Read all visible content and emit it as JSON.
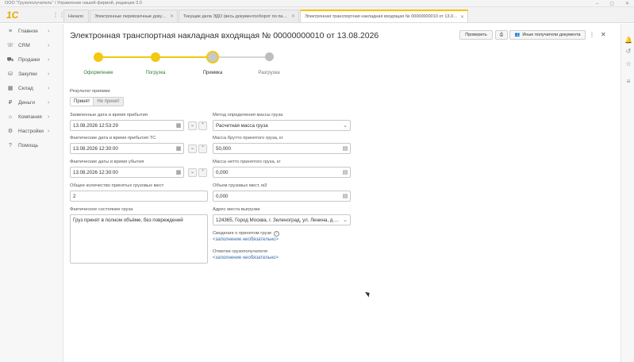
{
  "window": {
    "title": "ООО \"Грузополучатель\" / Управление нашей фирмой, редакция 3.0",
    "minimize": "–",
    "maximize": "▢",
    "close": "✕"
  },
  "logo": "1С",
  "tabs": [
    {
      "label": "Начало"
    },
    {
      "label": "Электронные перевозочные документы"
    },
    {
      "label": "Текущие дела ЭДО (весь документооборот по пакетам)"
    },
    {
      "label": "Электронная транспортная накладная входящая № 00000000010 от 13.08.2026"
    }
  ],
  "sidebar": {
    "items": [
      {
        "label": "Главное",
        "icon": "≡"
      },
      {
        "label": "CRM",
        "icon": "☏"
      },
      {
        "label": "Продажи",
        "icon": "⛟"
      },
      {
        "label": "Закупки",
        "icon": "⛁"
      },
      {
        "label": "Склад",
        "icon": "▦"
      },
      {
        "label": "Деньги",
        "icon": "₽"
      },
      {
        "label": "Компания",
        "icon": "⌂"
      },
      {
        "label": "Настройки",
        "icon": "⚙"
      },
      {
        "label": "Помощь",
        "icon": "?"
      }
    ]
  },
  "doc": {
    "title": "Электронная транспортная накладная входящая № 00000000010 от 13.08.2026",
    "check_button": "Проверить",
    "print_icon": "⎙",
    "other_recipients_button": "Иные получатели документа",
    "more_icon": "⋮",
    "close_icon": "✕"
  },
  "stepper": {
    "steps": [
      {
        "label": "Оформление",
        "state": "done"
      },
      {
        "label": "Погрузка",
        "state": "done"
      },
      {
        "label": "Приемка",
        "state": "current"
      },
      {
        "label": "Разгрузка",
        "state": "pending"
      }
    ],
    "colors": {
      "done": "#f2c811",
      "current": "#c8c8c8",
      "pending": "#bdbdbd",
      "done_label": "#2e7d32"
    }
  },
  "form": {
    "result_label": "Результат приемки",
    "result_accepted": "Принят",
    "result_rejected": "Не принят",
    "declared_arrival_label": "Заявленные дата и время прибытия",
    "declared_arrival_value": "13.08.2026 12:53:29",
    "actual_arrival_label": "Фактические дата и время прибытия ТС",
    "actual_arrival_value": "13.08.2026 12:30:00",
    "actual_departure_label": "Фактические даты и время убытия",
    "actual_departure_value": "13.08.2026 12:30:00",
    "places_label": "Общее количество принятых грузовых мест",
    "places_value": "2",
    "condition_label": "Фактическое состояние груза",
    "condition_value": "Груз принят в полном объёме, без повреждений",
    "method_label": "Метод определения массы груза",
    "method_value": "Расчетная масса груза",
    "gross_label": "Масса брутто принятого груза, кг",
    "gross_value": "50,000",
    "net_label": "Масса нетто принятого груза, кг",
    "net_value": "0,000",
    "volume_label": "Объем грузовых мест, м3",
    "volume_value": "0,000",
    "address_label": "Адрес места выгрузки",
    "address_value": "124365, Город Москва, г. Зеленоград, ул. Ленина, д. 2, к",
    "cargo_info_label": "Сведения о принятом грузе",
    "cargo_info_link": "<заполнение необязательно>",
    "consignee_marks_label": "Отметки грузополучателя",
    "consignee_marks_link": "<заполнение необязательно>"
  },
  "icons": {
    "calendar": "▦",
    "down": "⌄",
    "up": "⌃",
    "dropdown": "⌄",
    "calc": "▤",
    "info": "i",
    "chevron": "›"
  },
  "rail": {
    "bell": "🔔",
    "history": "↺",
    "star": "☆",
    "menu": "≡"
  }
}
